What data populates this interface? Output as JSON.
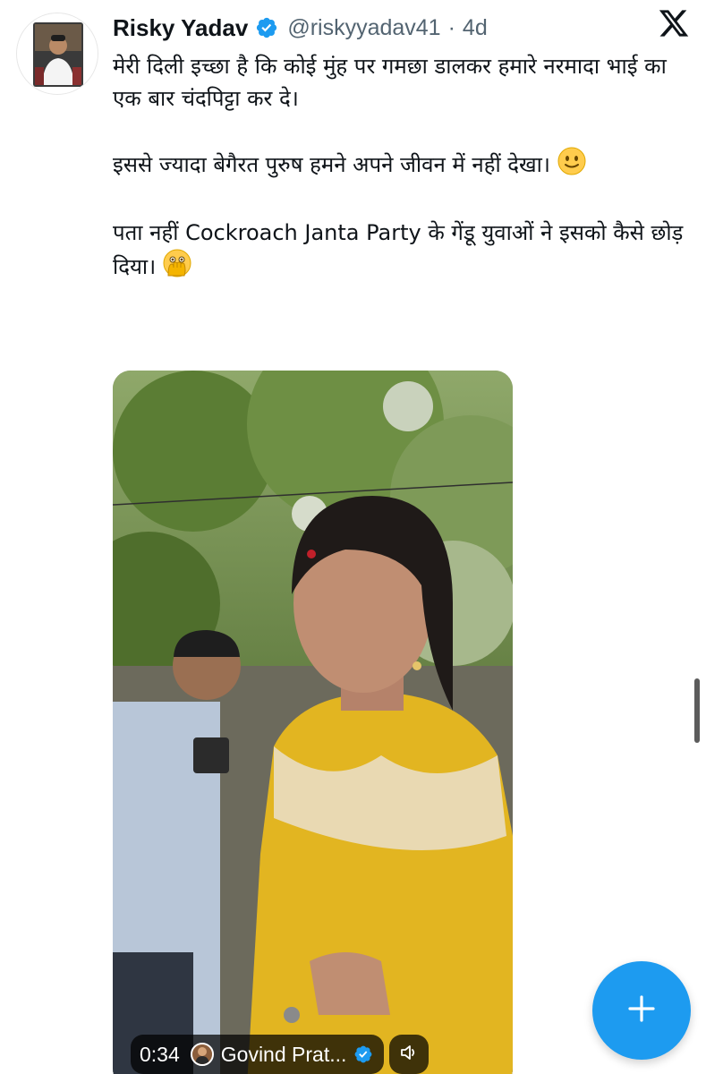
{
  "tweet": {
    "display_name": "Risky Yadav",
    "handle": "@riskyyadav41",
    "separator": "·",
    "time": "4d",
    "paragraphs": [
      "मेरी दिली इच्छा है कि कोई मुंह पर गमछा डालकर हमारे नरमादा भाई का एक बार चंदपिट्टा कर दे।",
      "इससे ज्यादा बेगैरत पुरुष हमने अपने जीवन में नहीं देखा।",
      "पता नहीं Cockroach Janta Party के गेंडू युवाओं ने इसको कैसे छोड़ दिया।"
    ]
  },
  "media": {
    "duration": "0:34",
    "author": "Govind Prat...",
    "sound_icon": "speaker-icon"
  },
  "icons": {
    "verified": "verified-badge-icon",
    "logo": "x-logo-icon",
    "compose": "plus-icon",
    "emoji_1": "slightly-smiling-face-emoji",
    "emoji_2": "face-with-open-eyes-and-hand-over-mouth-emoji"
  },
  "colors": {
    "accent": "#1d9bf0",
    "text": "#0f1419",
    "secondary": "#536471",
    "background": "#ffffff"
  }
}
